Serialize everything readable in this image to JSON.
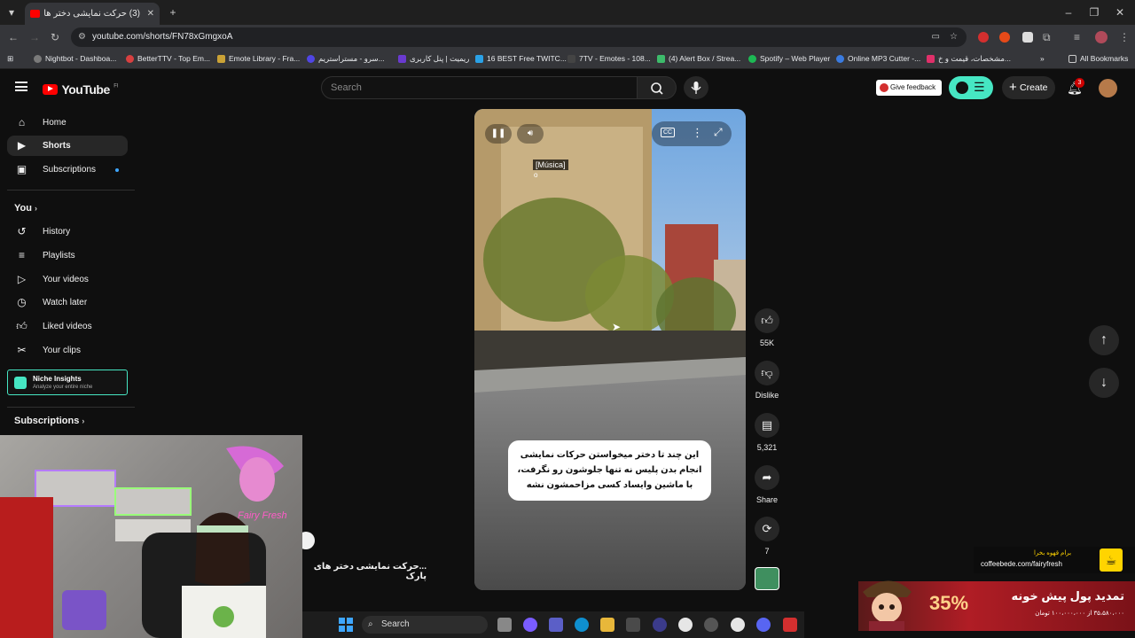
{
  "browser": {
    "tab_title": "(3) حرکت نمایشی دختر های پا",
    "url": "youtube.com/shorts/FN78xGmgxoA",
    "bookmarks": [
      "Nightbot - Dashboa...",
      "BetterTTV - Top Em...",
      "Emote Library - Fra...",
      "...سرو - مستراستریم",
      "ریمیت | پنل کاربری",
      "16 BEST Free TWITC...",
      "7TV - Emotes - 108...",
      "(4) Alert Box / Strea...",
      "Spotify – Web Player",
      "Online MP3 Cutter -...",
      "...مشخصات، قیمت و خ"
    ],
    "all_bookmarks": "All Bookmarks"
  },
  "youtube": {
    "logo_text": "YouTube",
    "logo_country": "FI",
    "search_placeholder": "Search",
    "give_feedback": "Give feedback",
    "create_label": "Create",
    "notif_count": "3"
  },
  "sidebar": {
    "items_top": [
      {
        "label": "Home",
        "icon": "home-icon"
      },
      {
        "label": "Shorts",
        "icon": "shorts-icon"
      },
      {
        "label": "Subscriptions",
        "icon": "subscriptions-icon"
      }
    ],
    "you_heading": "You",
    "items_you": [
      {
        "label": "History",
        "icon": "history-icon"
      },
      {
        "label": "Playlists",
        "icon": "playlists-icon"
      },
      {
        "label": "Your videos",
        "icon": "your-videos-icon"
      },
      {
        "label": "Watch later",
        "icon": "watch-later-icon"
      },
      {
        "label": "Liked videos",
        "icon": "liked-videos-icon"
      },
      {
        "label": "Your clips",
        "icon": "clips-icon"
      }
    ],
    "niche_title": "Niche Insights",
    "niche_subtitle": "Analyze your entire niche",
    "subscriptions_heading": "Subscriptions"
  },
  "short": {
    "overlay_musica": "[Música]",
    "overlay_o": "o",
    "caption_text": "این چند تا دختر میخواستن حرکات نمایشی انجام بدن پلیس نه تنها جلوشون رو نگرفت، با ماشین وایساد کسی مزاحمشون نشه",
    "side_title": "...حرکت نمایشی دختر های پارک",
    "cc_label": "CC"
  },
  "actions": {
    "likes": "55K",
    "dislike": "Dislike",
    "comments": "5,321",
    "share": "Share",
    "remix": "7"
  },
  "overlays": {
    "coffee_line1": "برام قهوه بخرا",
    "coffee_line2": "coffeebede.com/fairyfresh",
    "ad_percent": "35%",
    "ad_title": "تمدید پول پیش خونه",
    "ad_sub": "۳۵،۵۸۰،۰۰۰ از ۱۰۰،۰۰۰،۰۰۰ تومان"
  },
  "taskbar": {
    "search_label": "Search"
  },
  "colors": {
    "youtube_red": "#ff0000",
    "niche_accent": "#46e6c3",
    "background": "#0f0f0f"
  }
}
